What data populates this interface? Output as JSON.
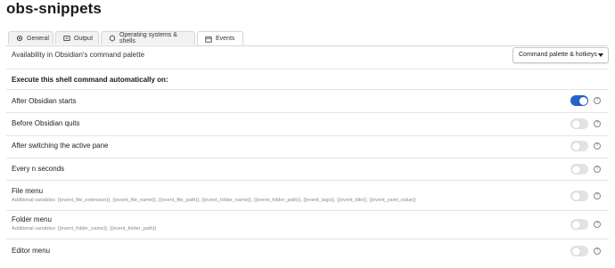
{
  "page": {
    "title": "obs-snippets"
  },
  "tabs": [
    {
      "label": "General",
      "icon": "gear-icon",
      "active": false
    },
    {
      "label": "Output",
      "icon": "output-icon",
      "active": false
    },
    {
      "label": "Operating systems & shells",
      "icon": "operating-systems-icon",
      "active": false
    },
    {
      "label": "Events",
      "icon": "events-icon",
      "active": true
    }
  ],
  "availability": {
    "label": "Availability in Obsidian's command palette",
    "selected": "Command palette & hotkeys"
  },
  "section": {
    "heading": "Execute this shell command automatically on:"
  },
  "events": [
    {
      "name": "After Obsidian starts",
      "description": "",
      "enabled": true
    },
    {
      "name": "Before Obsidian quits",
      "description": "",
      "enabled": false
    },
    {
      "name": "After switching the active pane",
      "description": "",
      "enabled": false
    },
    {
      "name": "Every n seconds",
      "description": "",
      "enabled": false
    },
    {
      "name": "File menu",
      "description": "Additional variables: {{event_file_extension}}, {{event_file_name}}, {{event_file_path}}, {{event_folder_name}}, {{event_folder_path}}, {{event_tags}}, {{event_title}}, {{event_yaml_value}}",
      "enabled": false
    },
    {
      "name": "Folder menu",
      "description": "Additional variables: {{event_folder_name}}, {{event_folder_path}}",
      "enabled": false
    },
    {
      "name": "Editor menu",
      "description": "",
      "enabled": false
    }
  ],
  "colors": {
    "accent": "#2563c9",
    "toggle_off": "#e3e3e3"
  },
  "help_icon": "help-icon"
}
